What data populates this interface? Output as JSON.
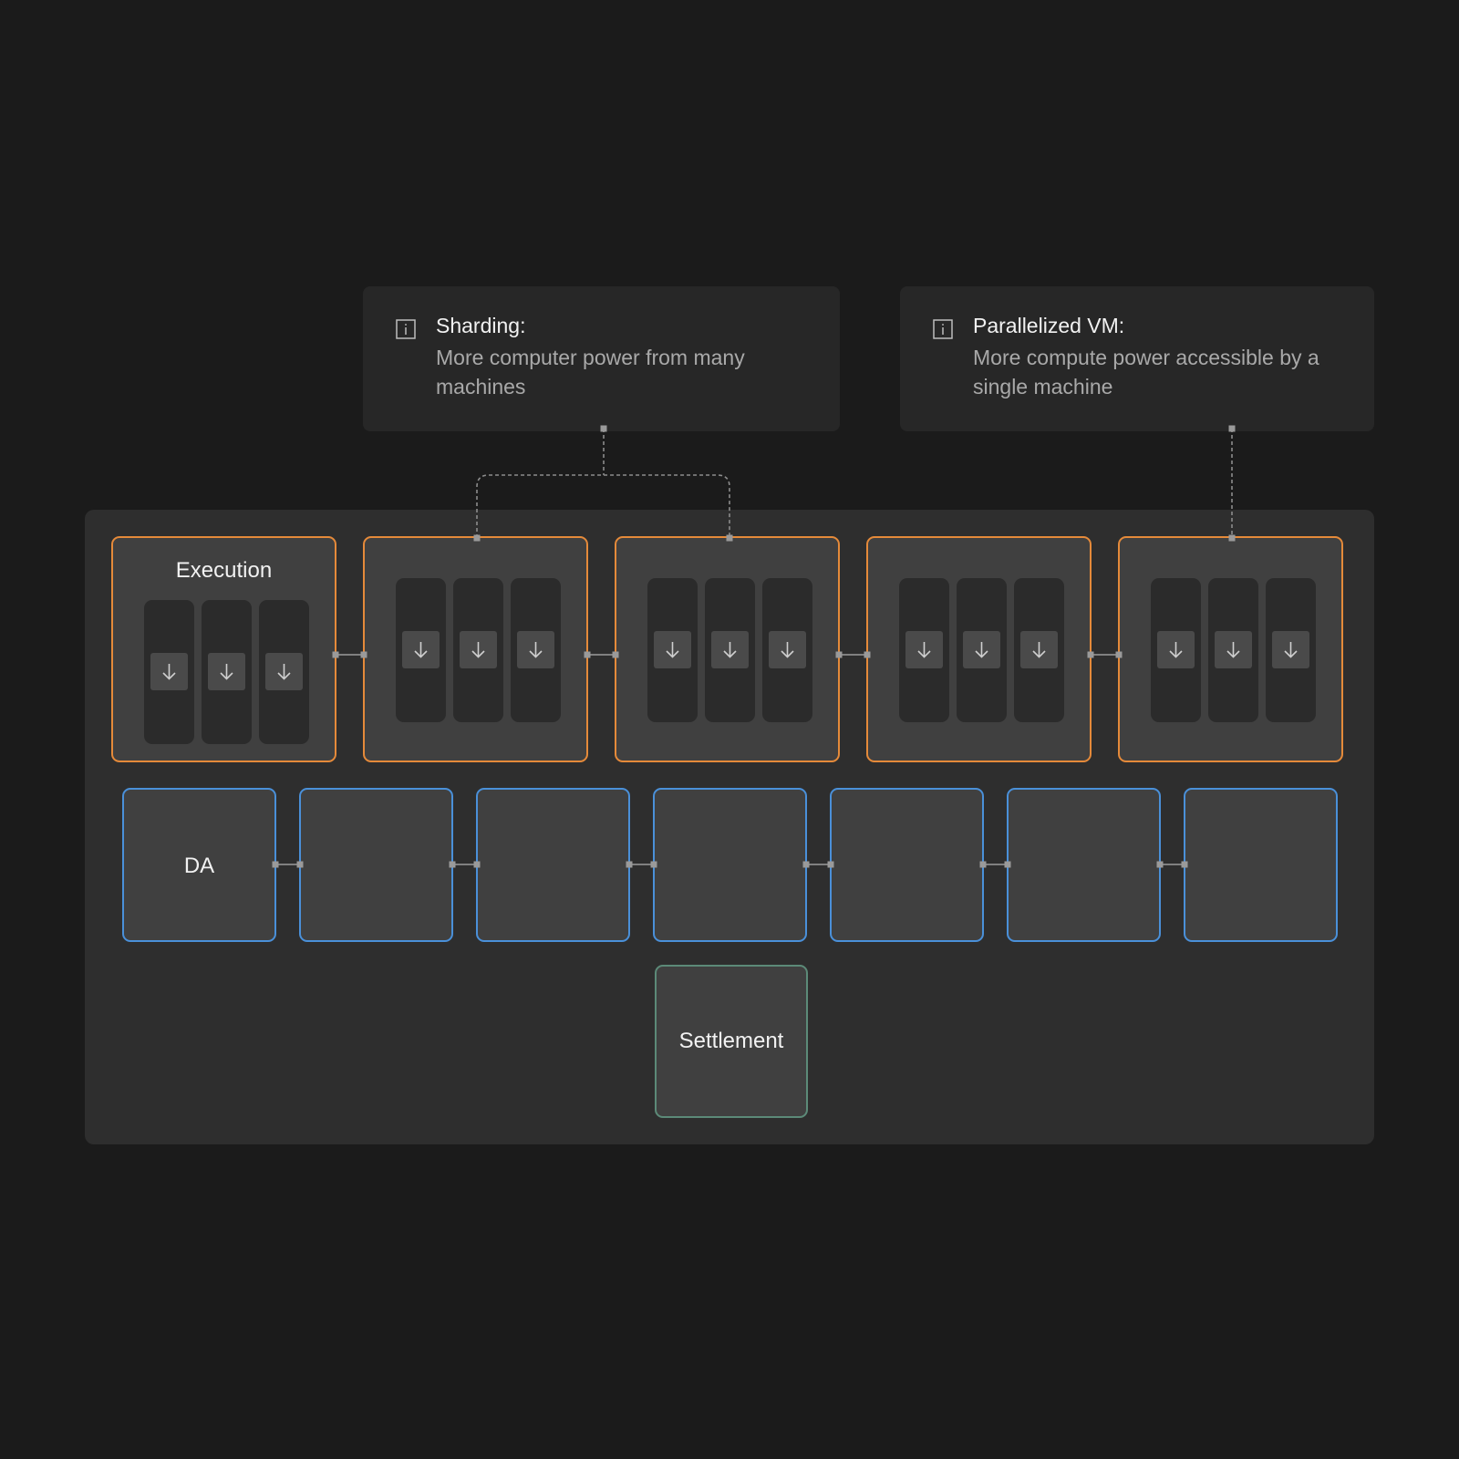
{
  "callouts": {
    "sharding": {
      "title": "Sharding:",
      "description": "More computer power from many machines",
      "icon": "info-icon"
    },
    "parallel_vm": {
      "title": "Parallelized VM:",
      "description": "More compute power accessible by a single machine",
      "icon": "info-icon"
    }
  },
  "layers": {
    "execution": {
      "label": "Execution",
      "block_count": 5,
      "lanes_per_block": 3,
      "border_color": "#e58a3a"
    },
    "da": {
      "label": "DA",
      "block_count": 7,
      "border_color": "#4a90d9"
    },
    "settlement": {
      "label": "Settlement",
      "border_color": "#5c8a78"
    }
  },
  "icons": {
    "lane_arrow": "arrow-down-icon",
    "callout": "info-icon"
  }
}
